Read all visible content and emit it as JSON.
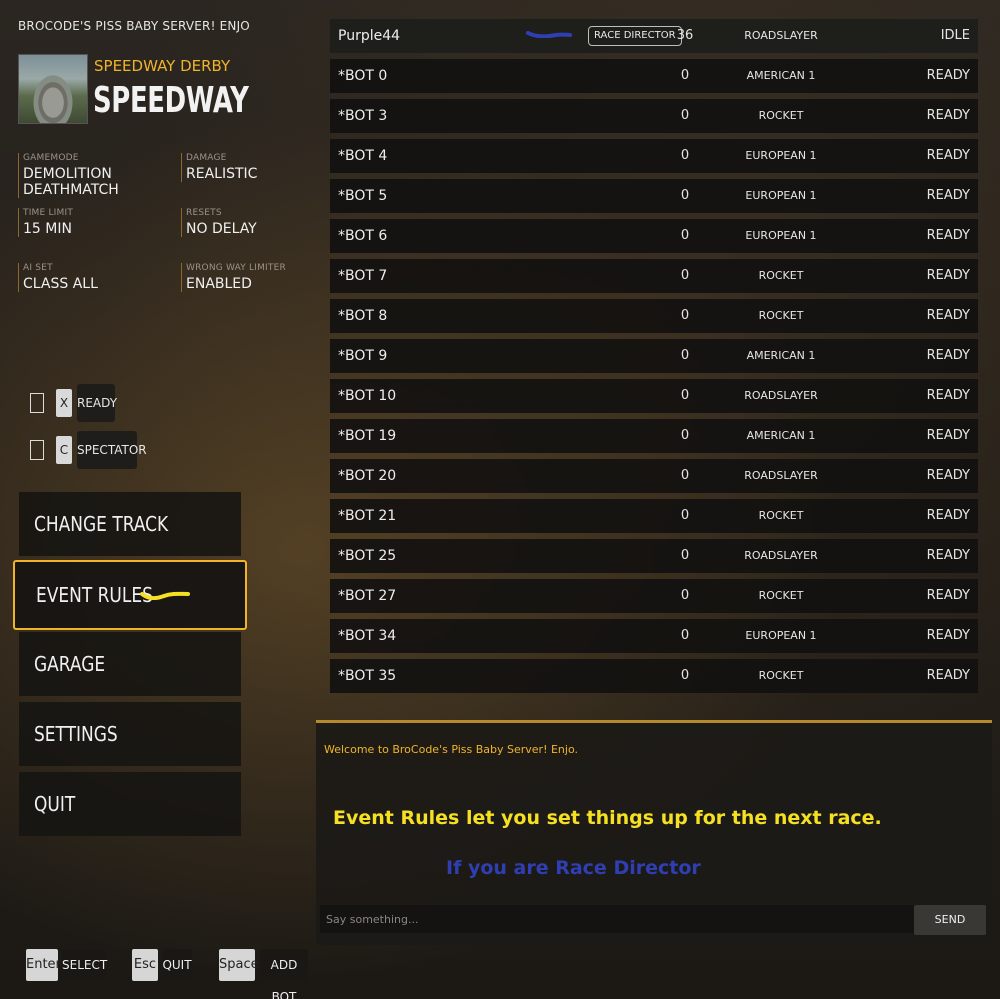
{
  "server": {
    "title": "BROCODE'S PISS BABY SERVER! ENJO"
  },
  "track": {
    "subtitle": "SPEEDWAY DERBY",
    "name": "SPEEDWAY"
  },
  "info": {
    "gamemode": {
      "label": "GAMEMODE",
      "value": "DEMOLITION DEATHMATCH"
    },
    "damage": {
      "label": "DAMAGE",
      "value": "REALISTIC"
    },
    "time_limit": {
      "label": "TIME LIMIT",
      "value": "15 MIN"
    },
    "resets": {
      "label": "RESETS",
      "value": "NO DELAY"
    },
    "ai_set": {
      "label": "AI SET",
      "value": "CLASS ALL"
    },
    "wrong_way": {
      "label": "WRONG WAY LIMITER",
      "value": "ENABLED"
    }
  },
  "toggles": [
    {
      "key": "X",
      "label": "READY"
    },
    {
      "key": "C",
      "label": "SPECTATOR"
    }
  ],
  "menu": {
    "change_track": "CHANGE TRACK",
    "event_rules": "EVENT RULES",
    "garage": "GARAGE",
    "settings": "SETTINGS",
    "quit": "QUIT"
  },
  "hints": [
    {
      "key": "Enter",
      "label": "SELECT"
    },
    {
      "key": "Esc",
      "label": "QUIT"
    },
    {
      "key": "Space",
      "label": "ADD BOT"
    }
  ],
  "players": [
    {
      "name": "Purple44",
      "badge": "RACE DIRECTOR",
      "score": "36",
      "car": "ROADSLAYER",
      "status": "IDLE"
    },
    {
      "name": "*BOT 0",
      "score": "0",
      "car": "AMERICAN 1",
      "status": "READY"
    },
    {
      "name": "*BOT 3",
      "score": "0",
      "car": "ROCKET",
      "status": "READY"
    },
    {
      "name": "*BOT 4",
      "score": "0",
      "car": "EUROPEAN 1",
      "status": "READY"
    },
    {
      "name": "*BOT 5",
      "score": "0",
      "car": "EUROPEAN 1",
      "status": "READY"
    },
    {
      "name": "*BOT 6",
      "score": "0",
      "car": "EUROPEAN 1",
      "status": "READY"
    },
    {
      "name": "*BOT 7",
      "score": "0",
      "car": "ROCKET",
      "status": "READY"
    },
    {
      "name": "*BOT 8",
      "score": "0",
      "car": "ROCKET",
      "status": "READY"
    },
    {
      "name": "*BOT 9",
      "score": "0",
      "car": "AMERICAN 1",
      "status": "READY"
    },
    {
      "name": "*BOT 10",
      "score": "0",
      "car": "ROADSLAYER",
      "status": "READY"
    },
    {
      "name": "*BOT 19",
      "score": "0",
      "car": "AMERICAN 1",
      "status": "READY"
    },
    {
      "name": "*BOT 20",
      "score": "0",
      "car": "ROADSLAYER",
      "status": "READY"
    },
    {
      "name": "*BOT 21",
      "score": "0",
      "car": "ROCKET",
      "status": "READY"
    },
    {
      "name": "*BOT 25",
      "score": "0",
      "car": "ROADSLAYER",
      "status": "READY"
    },
    {
      "name": "*BOT 27",
      "score": "0",
      "car": "ROCKET",
      "status": "READY"
    },
    {
      "name": "*BOT 34",
      "score": "0",
      "car": "EUROPEAN 1",
      "status": "READY"
    },
    {
      "name": "*BOT 35",
      "score": "0",
      "car": "ROCKET",
      "status": "READY"
    }
  ],
  "chat": {
    "welcome": "Welcome to BroCode's Piss Baby Server! Enjo.",
    "annotation_rules": "Event Rules let you set things up for the next race.",
    "annotation_rd": "If you are Race Director",
    "input_placeholder": "Say something...",
    "send_label": "SEND"
  },
  "colors": {
    "accent": "#f0b429",
    "annotation_yellow": "#f5e022",
    "annotation_blue": "#2f3fb3"
  }
}
